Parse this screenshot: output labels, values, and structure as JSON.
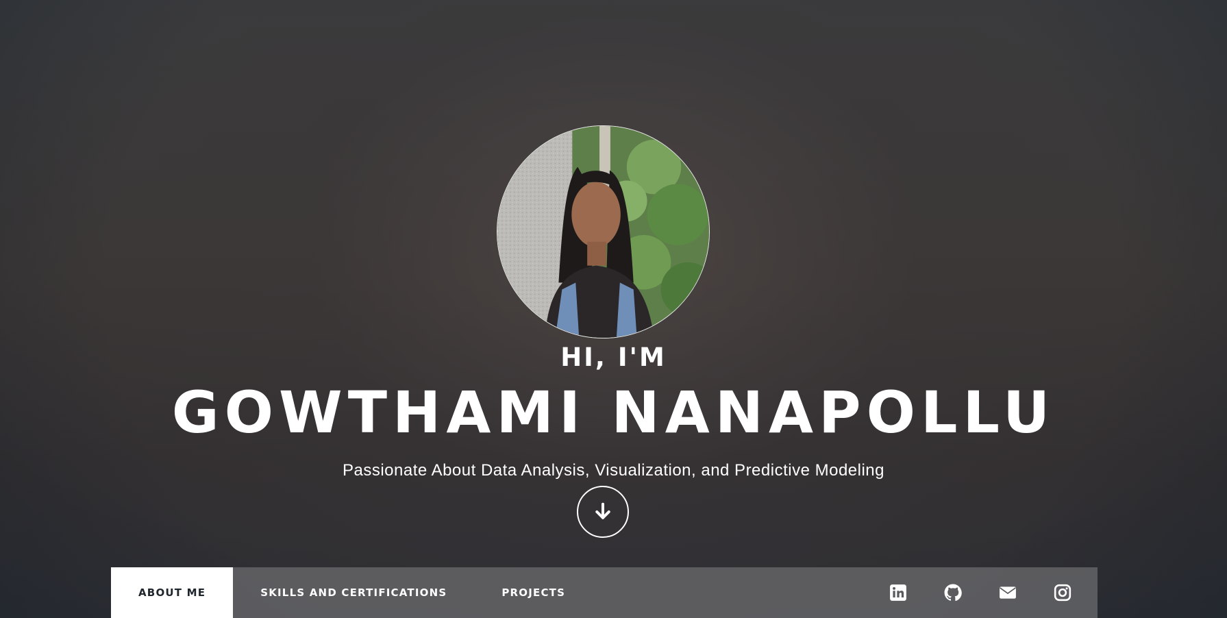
{
  "hero": {
    "greeting": "HI, I'M",
    "name": "GOWTHAMI NANAPOLLU",
    "tagline": "Passionate About Data Analysis, Visualization, and Predictive Modeling",
    "scroll_icon": "arrow-down-icon"
  },
  "nav": {
    "tabs": [
      {
        "label": "ABOUT ME",
        "active": true
      },
      {
        "label": "SKILLS AND CERTIFICATIONS",
        "active": false
      },
      {
        "label": "PROJECTS",
        "active": false
      }
    ],
    "social": [
      {
        "icon": "linkedin-icon"
      },
      {
        "icon": "github-icon"
      },
      {
        "icon": "envelope-icon"
      },
      {
        "icon": "instagram-icon"
      }
    ]
  },
  "colors": {
    "text": "#ffffff",
    "active_tab_bg": "#ffffff",
    "active_tab_text": "#1f252c",
    "navbar_bg": "#6e6e70"
  }
}
